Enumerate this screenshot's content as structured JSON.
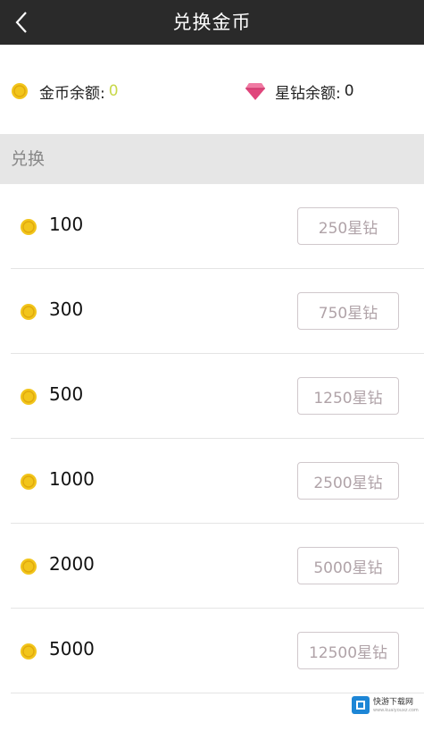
{
  "header": {
    "title": "兑换金币"
  },
  "balances": {
    "gold_label": "金币余额:",
    "gold_value": "0",
    "diamond_label": "星钻余额:",
    "diamond_value": "0"
  },
  "section": {
    "label": "兑换"
  },
  "items": [
    {
      "amount": "100",
      "price": "250星钻"
    },
    {
      "amount": "300",
      "price": "750星钻"
    },
    {
      "amount": "500",
      "price": "1250星钻"
    },
    {
      "amount": "1000",
      "price": "2500星钻"
    },
    {
      "amount": "2000",
      "price": "5000星钻"
    },
    {
      "amount": "5000",
      "price": "12500星钻"
    }
  ],
  "watermark": {
    "text": "快游下载网",
    "sub": "www.kuaiyouxz.com"
  },
  "colors": {
    "header_bg": "#2a2a2a",
    "coin": "#f2c51b",
    "diamond": "#e0457b",
    "gold_value": "#c8d84a"
  }
}
